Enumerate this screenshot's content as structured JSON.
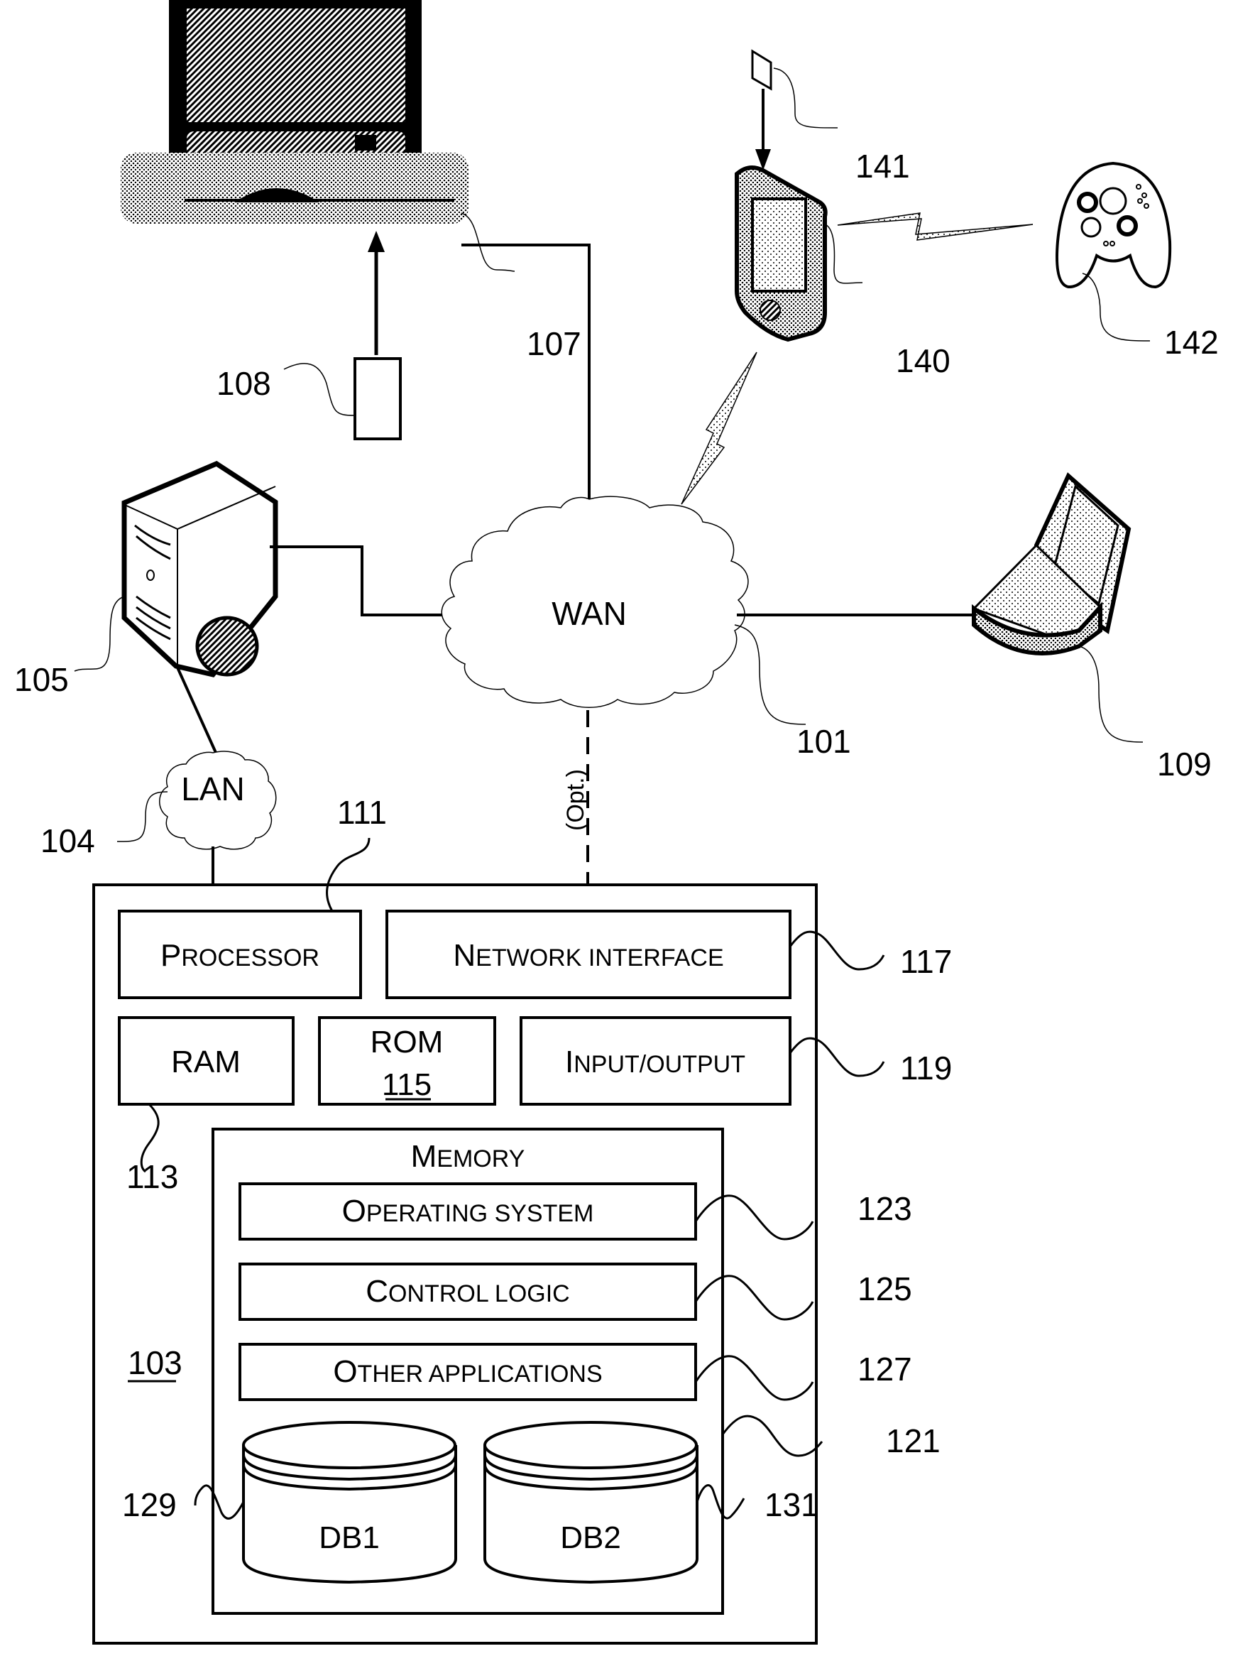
{
  "figure": {
    "network": {
      "wan_label": "WAN",
      "lan_label": "LAN",
      "optional_link_label": "(Opt.)"
    },
    "reference_numerals": {
      "wan": "101",
      "computer_103": "103",
      "lan": "104",
      "server": "105",
      "set_top_box": "107",
      "remote": "108",
      "laptop": "109",
      "processor": "111",
      "ram": "113",
      "network_interface": "117",
      "input_output": "119",
      "memory": "121",
      "operating_system": "123",
      "control_logic": "125",
      "other_applications": "127",
      "db1": "129",
      "db2": "131",
      "mobile_device": "140",
      "card": "141",
      "game_controller": "142"
    },
    "components": {
      "processor": {
        "first": "P",
        "rest": "ROCESSOR"
      },
      "network_interface": {
        "first": "N",
        "rest": "ETWORK INTERFACE"
      },
      "ram": "RAM",
      "rom": "ROM",
      "rom_number": "115",
      "input_output": {
        "first": "I",
        "rest": "NPUT/OUTPUT"
      },
      "memory": {
        "first": "M",
        "rest": "EMORY"
      },
      "operating_system": {
        "first": "O",
        "rest": "PERATING SYSTEM"
      },
      "control_logic": {
        "first": "C",
        "rest": "ONTROL LOGIC"
      },
      "other_applications": {
        "first": "O",
        "rest": "THER APPLICATIONS"
      },
      "db1": "DB1",
      "db2": "DB2"
    }
  }
}
